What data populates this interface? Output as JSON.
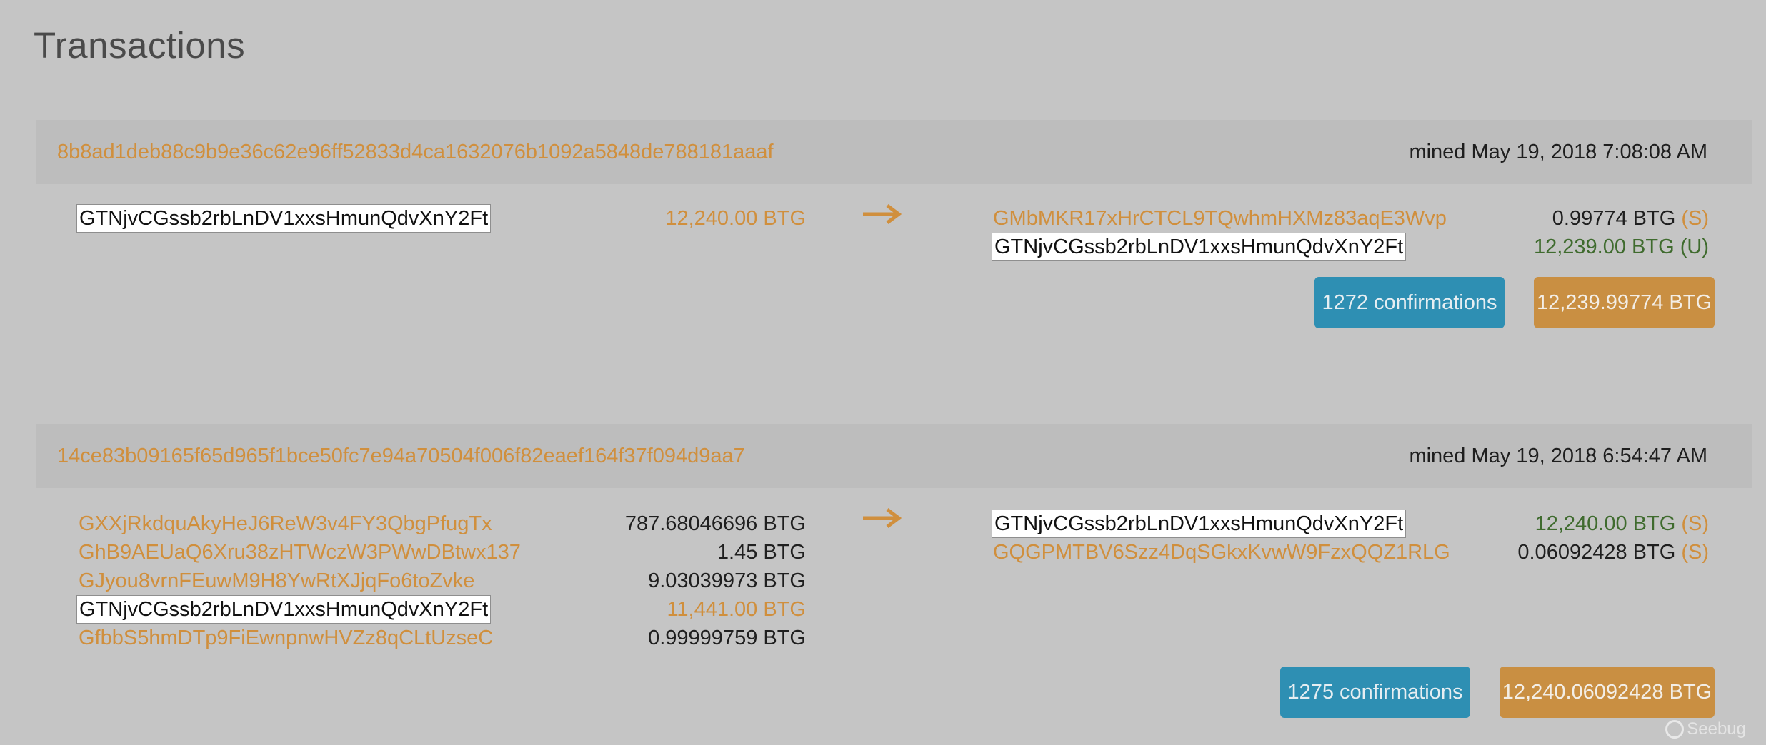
{
  "page": {
    "title": "Transactions"
  },
  "transactions": [
    {
      "hash": "8b8ad1deb88c9b9e36c62e96ff52833d4ca1632076b1092a5848de788181aaaf",
      "mined": "mined May 19, 2018 7:08:08 AM",
      "inputs": [
        {
          "address": "GTNjvCGssb2rbLnDV1xxsHmunQdvXnY2Ft",
          "highlighted": true,
          "amount": "12,240.00 BTG",
          "amount_color": "orange"
        }
      ],
      "outputs": [
        {
          "address": "GMbMKR17xHrCTCL9TQwhmHXMz83aqE3Wvp",
          "highlighted": false,
          "amount": "0.99774 BTG",
          "flag": "(S)",
          "amount_color": "dark"
        },
        {
          "address": "GTNjvCGssb2rbLnDV1xxsHmunQdvXnY2Ft",
          "highlighted": true,
          "amount": "12,239.00 BTG",
          "flag": "(U)",
          "amount_color": "green"
        }
      ],
      "confirmations": "1272 confirmations",
      "total": "12,239.99774 BTG"
    },
    {
      "hash": "14ce83b09165f65d965f1bce50fc7e94a70504f006f82eaef164f37f094d9aa7",
      "mined": "mined May 19, 2018 6:54:47 AM",
      "inputs": [
        {
          "address": "GXXjRkdquAkyHeJ6ReW3v4FY3QbgPfugTx",
          "highlighted": false,
          "amount": "787.68046696 BTG",
          "amount_color": "dark"
        },
        {
          "address": "GhB9AEUaQ6Xru38zHTWczW3PWwDBtwx137",
          "highlighted": false,
          "amount": "1.45 BTG",
          "amount_color": "dark"
        },
        {
          "address": "GJyou8vrnFEuwM9H8YwRtXJjqFo6toZvke",
          "highlighted": false,
          "amount": "9.03039973 BTG",
          "amount_color": "dark"
        },
        {
          "address": "GTNjvCGssb2rbLnDV1xxsHmunQdvXnY2Ft",
          "highlighted": true,
          "amount": "11,441.00 BTG",
          "amount_color": "orange"
        },
        {
          "address": "GfbbS5hmDTp9FiEwnpnwHVZz8qCLtUzseC",
          "highlighted": false,
          "amount": "0.99999759 BTG",
          "amount_color": "dark"
        }
      ],
      "outputs": [
        {
          "address": "GTNjvCGssb2rbLnDV1xxsHmunQdvXnY2Ft",
          "highlighted": true,
          "amount": "12,240.00 BTG",
          "flag": "(S)",
          "amount_color": "green"
        },
        {
          "address": "GQGPMTBV6Szz4DqSGkxKvwW9FzxQQZ1RLG",
          "highlighted": false,
          "amount": "0.06092428 BTG",
          "flag": "(S)",
          "amount_color": "dark"
        }
      ],
      "confirmations": "1275 confirmations",
      "total": "12,240.06092428 BTG"
    }
  ],
  "watermark": {
    "text": "Seebug"
  },
  "colors": {
    "accent": "#d08f3d",
    "confirm": "#2e8fb3",
    "total": "#c98f42",
    "green": "#3f6b2e",
    "background": "#c5c5c5"
  },
  "icons": {
    "arrow": "right-arrow-icon"
  }
}
